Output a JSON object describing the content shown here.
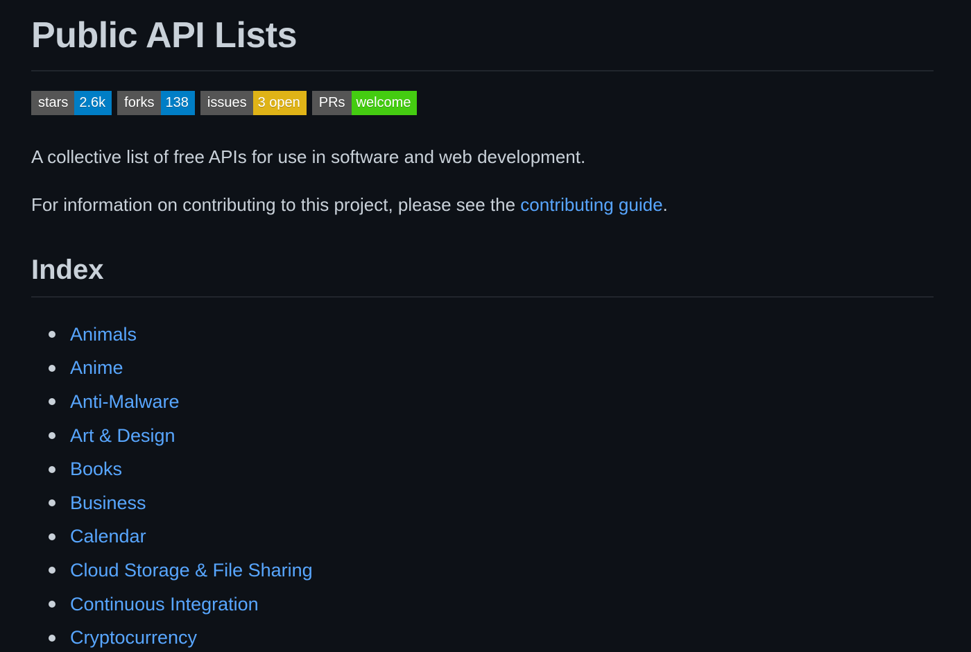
{
  "colors": {
    "background": "#0d1117",
    "text": "#c9d1d9",
    "link": "#58a6ff",
    "rule": "#21262d",
    "badge_label_bg": "#555555"
  },
  "header": {
    "title": "Public API Lists"
  },
  "badges": [
    {
      "label": "stars",
      "value": "2.6k",
      "color": "#007ec6"
    },
    {
      "label": "forks",
      "value": "138",
      "color": "#007ec6"
    },
    {
      "label": "issues",
      "value": "3 open",
      "color": "#dfb317"
    },
    {
      "label": "PRs",
      "value": "welcome",
      "color": "#4c1"
    }
  ],
  "content": {
    "description": "A collective list of free APIs for use in software and web development.",
    "info_prefix": "For information on contributing to this project, please see the ",
    "info_link": "contributing guide",
    "info_suffix": "."
  },
  "index": {
    "heading": "Index",
    "items": [
      "Animals",
      "Anime",
      "Anti-Malware",
      "Art & Design",
      "Books",
      "Business",
      "Calendar",
      "Cloud Storage & File Sharing",
      "Continuous Integration",
      "Cryptocurrency"
    ]
  }
}
